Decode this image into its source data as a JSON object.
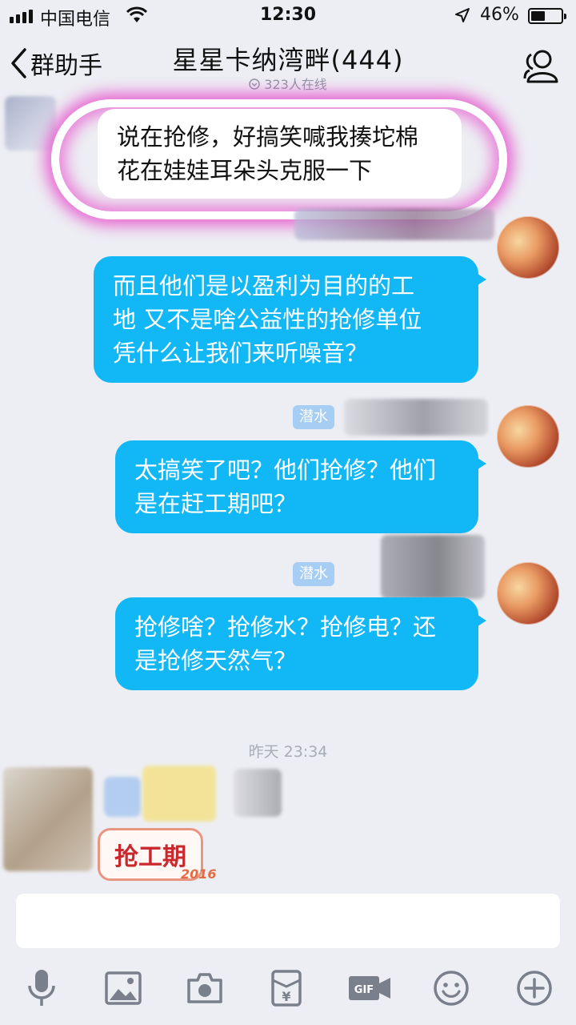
{
  "status_bar": {
    "carrier": "中国电信",
    "time": "12:30",
    "battery": "46%",
    "battery_level": 0.46
  },
  "nav": {
    "back_label": "群助手",
    "title": "星星卡纳湾畔(444)",
    "subtitle": "323人在线"
  },
  "messages": [
    {
      "side": "left",
      "text_lines": [
        "说在抢修，好搞笑喊我揍坨棉",
        "花在娃娃耳朵头克服一下"
      ]
    },
    {
      "side": "right",
      "text_lines": [
        "而且他们是以盈利为目的的工",
        "地 又不是啥公益性的抢修单位",
        "凭什么让我们来听噪音？"
      ]
    },
    {
      "side": "right",
      "tag": "潜水",
      "text_lines": [
        "太搞笑了吧？他们抢修？他们",
        "是在赶工期吧？"
      ]
    },
    {
      "side": "right",
      "tag": "潜水",
      "text_lines": [
        "抢修啥？抢修水？抢修电？还",
        "是抢修天然气？"
      ]
    }
  ],
  "timestamp": "昨天 23:34",
  "sticker": {
    "text": "抢工期",
    "year": "2016"
  },
  "toolbar": [
    "microphone-icon",
    "image-icon",
    "camera-icon",
    "red-packet-icon",
    "gif-icon",
    "emoji-icon",
    "plus-icon"
  ],
  "colors": {
    "bubble_blue": "#12b7f5",
    "background": "#edeef3",
    "highlight": "#e63cc8"
  }
}
